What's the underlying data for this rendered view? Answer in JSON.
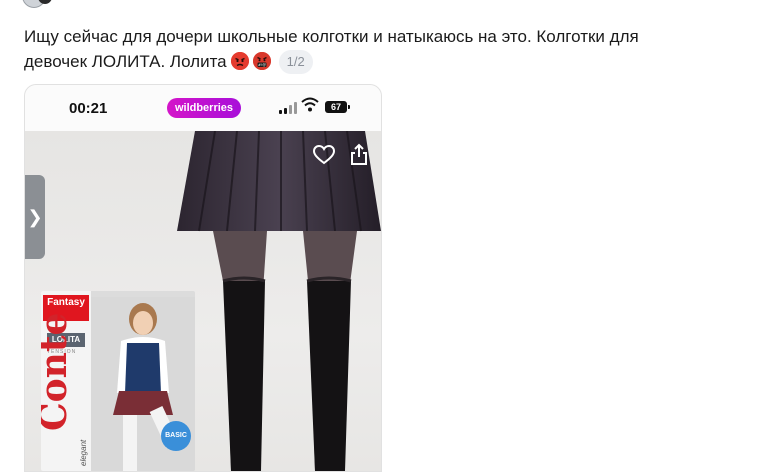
{
  "post": {
    "text_line1": "Ищу сейчас для дочери школьные колготки и натыкаюсь на это. Колготки для",
    "text_line2": "девочек ЛОЛИТА. Лолита",
    "reactions": [
      "angry-face-emoji",
      "cursing-face-emoji"
    ],
    "image_counter": "1/2"
  },
  "phone_screenshot": {
    "status_bar": {
      "time": "00:21",
      "app_badge": "wildberries",
      "battery": "67"
    },
    "product": {
      "package_brand": "Fantasy",
      "package_model": "LOLITA",
      "package_subtitle": "TENSION",
      "package_logo": "Conte",
      "package_tagline": "elegant",
      "package_badge": "BASIC"
    },
    "icons": [
      "back-chevron-icon",
      "heart-icon",
      "share-icon"
    ],
    "colors": {
      "wb_gradient_start": "#d415c9",
      "wb_gradient_end": "#a80fd9",
      "fantasy_red": "#e0161f",
      "conte_red": "#d2232a"
    }
  }
}
